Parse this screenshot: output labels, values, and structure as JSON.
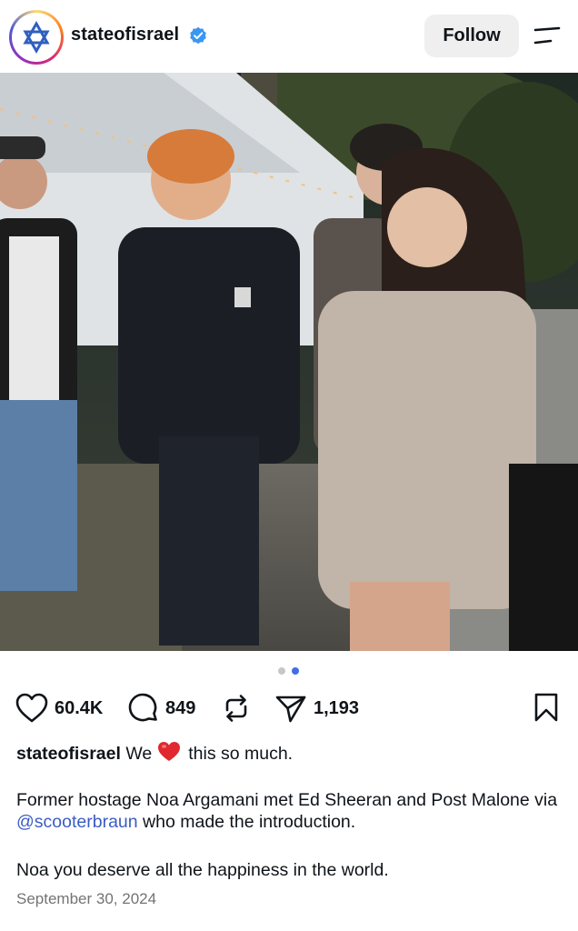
{
  "account": {
    "username": "stateofisrael",
    "verified": true
  },
  "header": {
    "follow_label": "Follow"
  },
  "carousel": {
    "total": 2,
    "active_index": 2
  },
  "actions": {
    "likes": "60.4K",
    "comments": "849",
    "shares": "1,193"
  },
  "caption": {
    "username": "stateofisrael",
    "text_before_emoji": "We",
    "emoji": "red-heart",
    "text_after_emoji": "this so much.",
    "para2_before": "Former hostage Noa Argamani met Ed Sheeran and Post Malone via ",
    "mention": "@scooterbraun",
    "para2_after": " who made the introduction.",
    "para3": "Noa you deserve all the happiness in the world."
  },
  "date": "September 30, 2024",
  "colors": {
    "verified_blue": "#3897f0",
    "mention_blue": "#3b5cc4",
    "active_dot": "#3f6ee8",
    "follow_bg": "#efefef"
  }
}
